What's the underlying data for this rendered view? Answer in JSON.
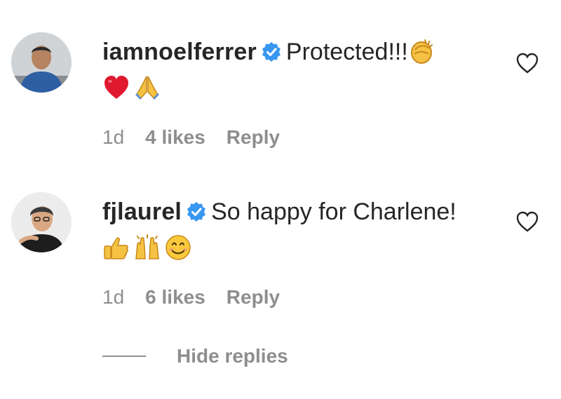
{
  "comments": [
    {
      "username": "iamnoelferrer",
      "text": "Protected!!!",
      "emojis": [
        "clapping-hands",
        "red-heart",
        "folded-hands"
      ],
      "age": "1d",
      "likes": "4 likes",
      "reply": "Reply"
    },
    {
      "username": "fjlaurel",
      "text": "So happy for Charlene!",
      "emojis": [
        "thumbs-up",
        "raising-hands",
        "smiling-face"
      ],
      "age": "1d",
      "likes": "6 likes",
      "reply": "Reply"
    }
  ],
  "hide_replies": "Hide replies",
  "colors": {
    "verified": "#3897f0",
    "meta_text": "#8e8e8e",
    "primary_text": "#262626"
  }
}
